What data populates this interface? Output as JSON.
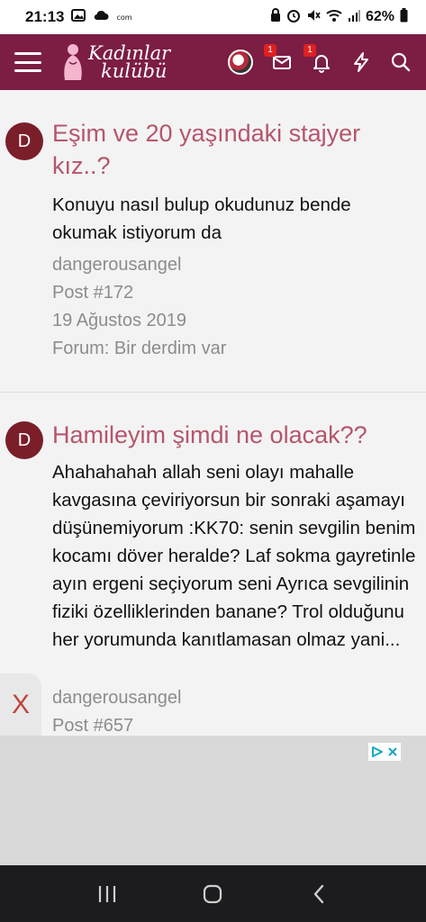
{
  "status_bar": {
    "time": "21:13",
    "battery": "62%",
    "notif_icons": [
      "gallery-icon",
      "cloud-icon",
      "com-text"
    ]
  },
  "header": {
    "logo_line1": "Kadınlar",
    "logo_line2": "kulübü",
    "messages_badge": "1",
    "alerts_badge": "1"
  },
  "posts": [
    {
      "avatar_letter": "D",
      "title": "Eşim ve 20 yaşındaki stajyer kız..?",
      "snippet": "Konuyu nasıl bulup okudunuz bende okumak istiyorum da",
      "author": "dangerousangel",
      "post_number": "Post #172",
      "date": "19 Ağustos 2019",
      "forum": "Forum: Bir derdim var"
    },
    {
      "avatar_letter": "D",
      "title": "Hamileyim şimdi ne olacak??",
      "snippet": "Ahahahahah allah seni olayı mahalle kavgasına çeviriyorsun bir sonraki aşamayı düşünemiyorum :KK70: senin sevgilin benim kocamı döver heralde? Laf sokma gayretinle ayın ergeni seçiyorum seni Ayrıca sevgilinin fiziki özelliklerinden banane? Trol olduğunu her yorumunda kanıtlamasan olmaz yani...",
      "author": "dangerousangel",
      "post_number": "Post #657"
    }
  ],
  "ad": {
    "close_label": "X"
  },
  "colors": {
    "header_bg": "#7c1d43",
    "title": "#b5566b",
    "avatar_bg": "#7a1e2a",
    "meta": "#8c8c8c"
  }
}
